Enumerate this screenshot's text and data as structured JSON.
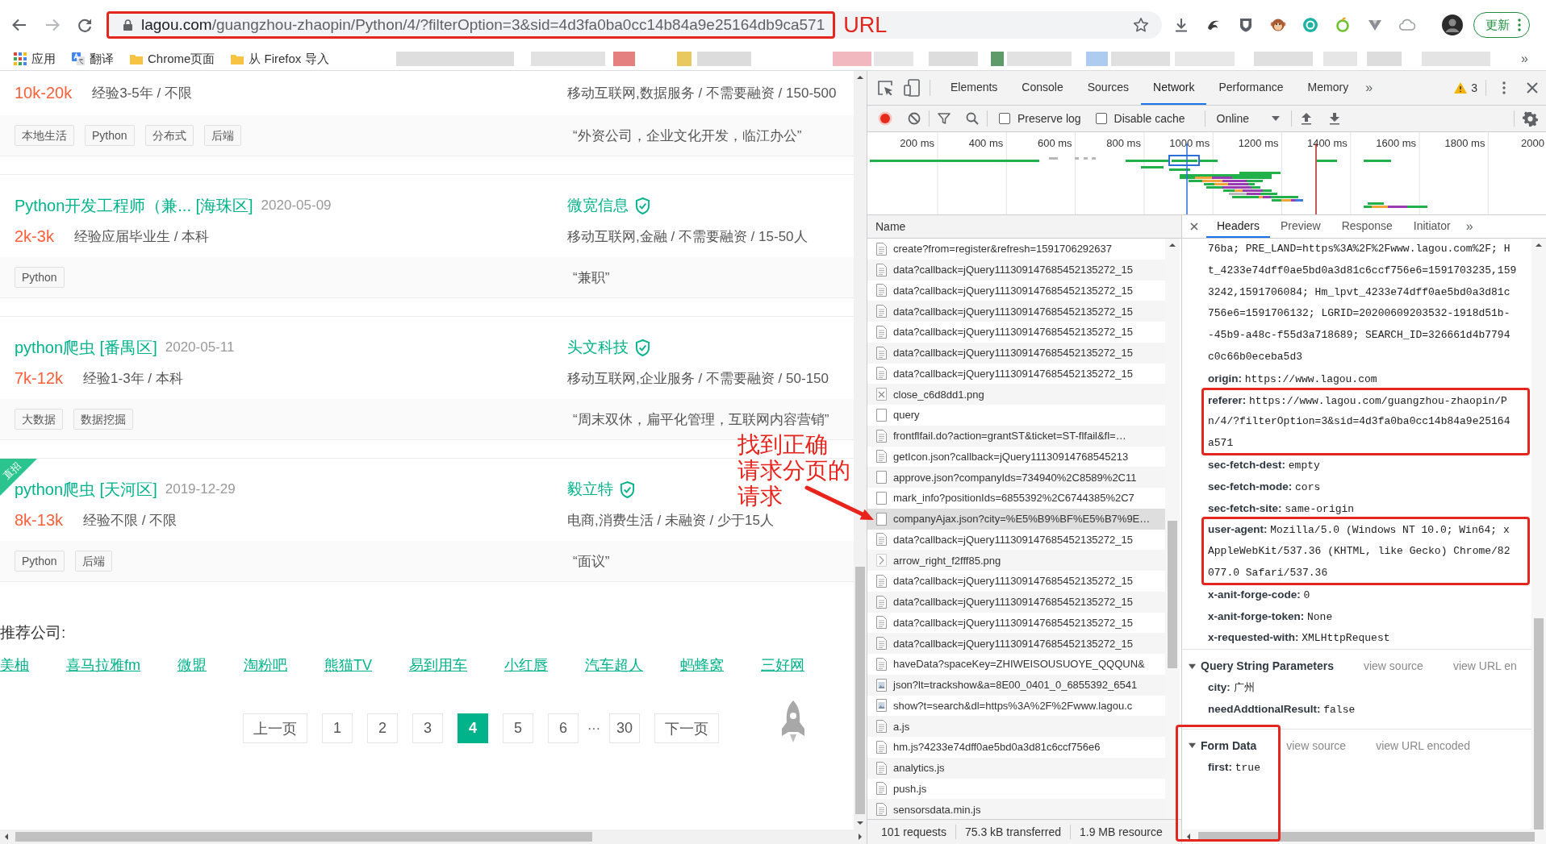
{
  "browser": {
    "address": {
      "host": "lagou.com",
      "path": "/guangzhou-zhaopin/Python/4/?filterOption=3&sid=4d3fa0ba0cc14b84a9e25164db9ca571",
      "highlighted": true,
      "annotation": "URL"
    },
    "update_button": "更新",
    "bookmarks": [
      {
        "kind": "apps",
        "label": "应用"
      },
      {
        "kind": "translate",
        "label": "翻译"
      },
      {
        "kind": "folder",
        "label": "Chrome页面"
      },
      {
        "kind": "folder",
        "label": "从 Firefox 导入"
      }
    ],
    "more_bookmarks": "»"
  },
  "page": {
    "jobs": [
      {
        "salary": "10k-20k",
        "experience": "经验3-5年 / 不限",
        "industry": "移动互联网,数据服务 / 不需要融资 / 150-500",
        "tags": [
          "本地生活",
          "Python",
          "分布式",
          "后端"
        ],
        "quote": "“外资公司，企业文化开发，临江办公”"
      },
      {
        "title": "Python开发工程师（兼... [海珠区]",
        "date": "2020-05-09",
        "company": "微宽信息",
        "verified": true,
        "salary": "2k-3k",
        "experience": "经验应届毕业生 / 本科",
        "industry": "移动互联网,金融 / 不需要融资 / 15-50人",
        "tags": [
          "Python"
        ],
        "quote": "“兼职”"
      },
      {
        "title": "python爬虫 [番禺区]",
        "date": "2020-05-11",
        "company": "头文科技",
        "verified": true,
        "salary": "7k-12k",
        "experience": "经验1-3年 / 本科",
        "industry": "移动互联网,企业服务 / 不需要融资 / 50-150",
        "tags": [
          "大数据",
          "数据挖掘"
        ],
        "quote": "“周末双休，扁平化管理，互联网内容营销”"
      },
      {
        "badge": "直招",
        "title": "python爬虫 [天河区]",
        "date": "2019-12-29",
        "company": "毅立特",
        "verified": true,
        "salary": "8k-13k",
        "experience": "经验不限 / 不限",
        "industry": "电商,消费生活 / 未融资 / 少于15人",
        "tags": [
          "Python",
          "后端"
        ],
        "quote": "“面议”"
      }
    ],
    "recommend": {
      "label": "推荐公司:",
      "companies": [
        "美柚",
        "喜马拉雅fm",
        "微盟",
        "淘粉吧",
        "熊猫TV",
        "易到用车",
        "小红唇",
        "汽车超人",
        "蚂蜂窝",
        "三好网"
      ]
    },
    "pagination": {
      "prev": "上一页",
      "next": "下一页",
      "items": [
        {
          "kind": "page",
          "label": "1",
          "selected": false
        },
        {
          "kind": "page",
          "label": "2",
          "selected": false
        },
        {
          "kind": "page",
          "label": "3",
          "selected": false
        },
        {
          "kind": "page",
          "label": "4",
          "selected": true
        },
        {
          "kind": "page",
          "label": "5",
          "selected": false
        },
        {
          "kind": "page",
          "label": "6",
          "selected": false
        },
        {
          "kind": "ellipsis",
          "label": "···",
          "selected": false
        },
        {
          "kind": "page",
          "label": "30",
          "selected": false
        }
      ]
    }
  },
  "devtools": {
    "tabs": [
      {
        "label": "Elements",
        "selected": false
      },
      {
        "label": "Console",
        "selected": false
      },
      {
        "label": "Sources",
        "selected": false
      },
      {
        "label": "Network",
        "selected": true
      },
      {
        "label": "Performance",
        "selected": false
      },
      {
        "label": "Memory",
        "selected": false
      }
    ],
    "more_tabs": "»",
    "warning_count": "3",
    "recording": true,
    "preserve_log": {
      "label": "Preserve log",
      "checked": false
    },
    "disable_cache": {
      "label": "Disable cache",
      "checked": false
    },
    "throttling": "Online",
    "timeline_ticks": [
      "200 ms",
      "400 ms",
      "600 ms",
      "800 ms",
      "1000 ms",
      "1200 ms",
      "1400 ms",
      "1600 ms",
      "1800 ms",
      "2000"
    ],
    "requests": {
      "column": "Name",
      "rows": [
        {
          "name": "create?from=register&refresh=1591706292637",
          "kind": "doc",
          "selected": false
        },
        {
          "name": "data?callback=jQuery111309147685452135272_15",
          "kind": "doc",
          "selected": false
        },
        {
          "name": "data?callback=jQuery111309147685452135272_15",
          "kind": "doc",
          "selected": false
        },
        {
          "name": "data?callback=jQuery111309147685452135272_15",
          "kind": "doc",
          "selected": false
        },
        {
          "name": "data?callback=jQuery111309147685452135272_15",
          "kind": "doc",
          "selected": false
        },
        {
          "name": "data?callback=jQuery111309147685452135272_15",
          "kind": "doc",
          "selected": false
        },
        {
          "name": "data?callback=jQuery111309147685452135272_15",
          "kind": "doc",
          "selected": false
        },
        {
          "name": "close_c6d8dd1.png",
          "kind": "cross",
          "selected": false
        },
        {
          "name": "query",
          "kind": "blank",
          "selected": false
        },
        {
          "name": "frontflfail.do?action=grantST&ticket=ST-flfail&fl=…",
          "kind": "doc",
          "selected": false
        },
        {
          "name": "getIcon.json?callback=jQuery11130914768545213",
          "kind": "doc",
          "selected": false
        },
        {
          "name": "approve.json?companyIds=734940%2C8589%2C11",
          "kind": "blank",
          "selected": false
        },
        {
          "name": "mark_info?positionIds=6855392%2C6744385%2C7",
          "kind": "blank",
          "selected": false
        },
        {
          "name": "companyAjax.json?city=%E5%B9%BF%E5%B7%9E…",
          "kind": "blank",
          "selected": true
        },
        {
          "name": "data?callback=jQuery111309147685452135272_15",
          "kind": "doc",
          "selected": false
        },
        {
          "name": "arrow_right_f2fff85.png",
          "kind": "chevron",
          "selected": false
        },
        {
          "name": "data?callback=jQuery111309147685452135272_15",
          "kind": "doc",
          "selected": false
        },
        {
          "name": "data?callback=jQuery111309147685452135272_15",
          "kind": "doc",
          "selected": false
        },
        {
          "name": "data?callback=jQuery111309147685452135272_15",
          "kind": "doc",
          "selected": false
        },
        {
          "name": "data?callback=jQuery111309147685452135272_15",
          "kind": "doc",
          "selected": false
        },
        {
          "name": "haveData?spaceKey=ZHIWEISOUSUOYE_QQQUN&",
          "kind": "doc",
          "selected": false
        },
        {
          "name": "json?lt=trackshow&a=8E00_0401_0_6855392_6541",
          "kind": "image",
          "selected": false
        },
        {
          "name": "show?t=search&dl=https%3A%2F%2Fwww.lagou.c",
          "kind": "image",
          "selected": false
        },
        {
          "name": "a.js",
          "kind": "doc",
          "selected": false
        },
        {
          "name": "hm.js?4233e74dff0ae5bd0a3d81c6ccf756e6",
          "kind": "doc",
          "selected": false
        },
        {
          "name": "analytics.js",
          "kind": "doc",
          "selected": false
        },
        {
          "name": "push.js",
          "kind": "doc",
          "selected": false
        },
        {
          "name": "sensorsdata.min.js",
          "kind": "doc",
          "selected": false
        }
      ],
      "status": [
        "101 requests",
        "75.3 kB transferred",
        "1.9 MB resource"
      ]
    },
    "detail": {
      "tabs": [
        {
          "label": "Headers",
          "selected": true
        },
        {
          "label": "Preview",
          "selected": false
        },
        {
          "label": "Response",
          "selected": false
        },
        {
          "label": "Initiator",
          "selected": false
        }
      ],
      "more_tabs": "»",
      "headers": [
        {
          "lines": [
            "76ba; PRE_LAND=https%3A%2F%2Fwww.lagou.com%2F; H",
            "t_4233e74dff0ae5bd0a3d81c6ccf756e6=1591703235,159",
            "3242,1591706084; Hm_lpvt_4233e74dff0ae5bd0a3d81c",
            "756e6=1591706132; LGRID=20200609203532-1918d51b-",
            "-45b9-a48c-f55d3a718689; SEARCH_ID=326661d4b7794",
            "c0c66b0eceba5d3"
          ],
          "highlighted": false
        },
        {
          "key": "origin:",
          "lines": [
            "https://www.lagou.com"
          ],
          "highlighted": false
        },
        {
          "key": "referer:",
          "lines": [
            "https://www.lagou.com/guangzhou-zhaopin/P",
            "n/4/?filterOption=3&sid=4d3fa0ba0cc14b84a9e25164",
            "a571"
          ],
          "highlighted": true
        },
        {
          "key": "sec-fetch-dest:",
          "lines": [
            "empty"
          ],
          "highlighted": false
        },
        {
          "key": "sec-fetch-mode:",
          "lines": [
            "cors"
          ],
          "highlighted": false
        },
        {
          "key": "sec-fetch-site:",
          "lines": [
            "same-origin"
          ],
          "highlighted": false
        },
        {
          "key": "user-agent:",
          "lines": [
            "Mozilla/5.0 (Windows NT 10.0; Win64; x",
            "AppleWebKit/537.36 (KHTML, like Gecko) Chrome/82",
            "077.0 Safari/537.36"
          ],
          "highlighted": true
        },
        {
          "key": "x-anit-forge-code:",
          "lines": [
            "0"
          ],
          "highlighted": false
        },
        {
          "key": "x-anit-forge-token:",
          "lines": [
            "None"
          ],
          "highlighted": false
        },
        {
          "key": "x-requested-with:",
          "lines": [
            "XMLHttpRequest"
          ],
          "highlighted": false
        }
      ],
      "sections": [
        {
          "title": "Query String Parameters",
          "expanded": true,
          "links": [
            "view source",
            "view URL en"
          ],
          "params": [
            {
              "key": "city:",
              "value": "广州"
            },
            {
              "key": "needAddtionalResult:",
              "value": "false"
            }
          ],
          "highlighted": false
        },
        {
          "title": "Form Data",
          "expanded": true,
          "links": [
            "view source",
            "view URL encoded"
          ],
          "params": [
            {
              "key": "first:",
              "value": "true"
            }
          ],
          "highlighted": true
        }
      ]
    }
  },
  "annotations": {
    "note": [
      "找到正确",
      "请求分页的",
      "请求"
    ],
    "arrow": true
  }
}
